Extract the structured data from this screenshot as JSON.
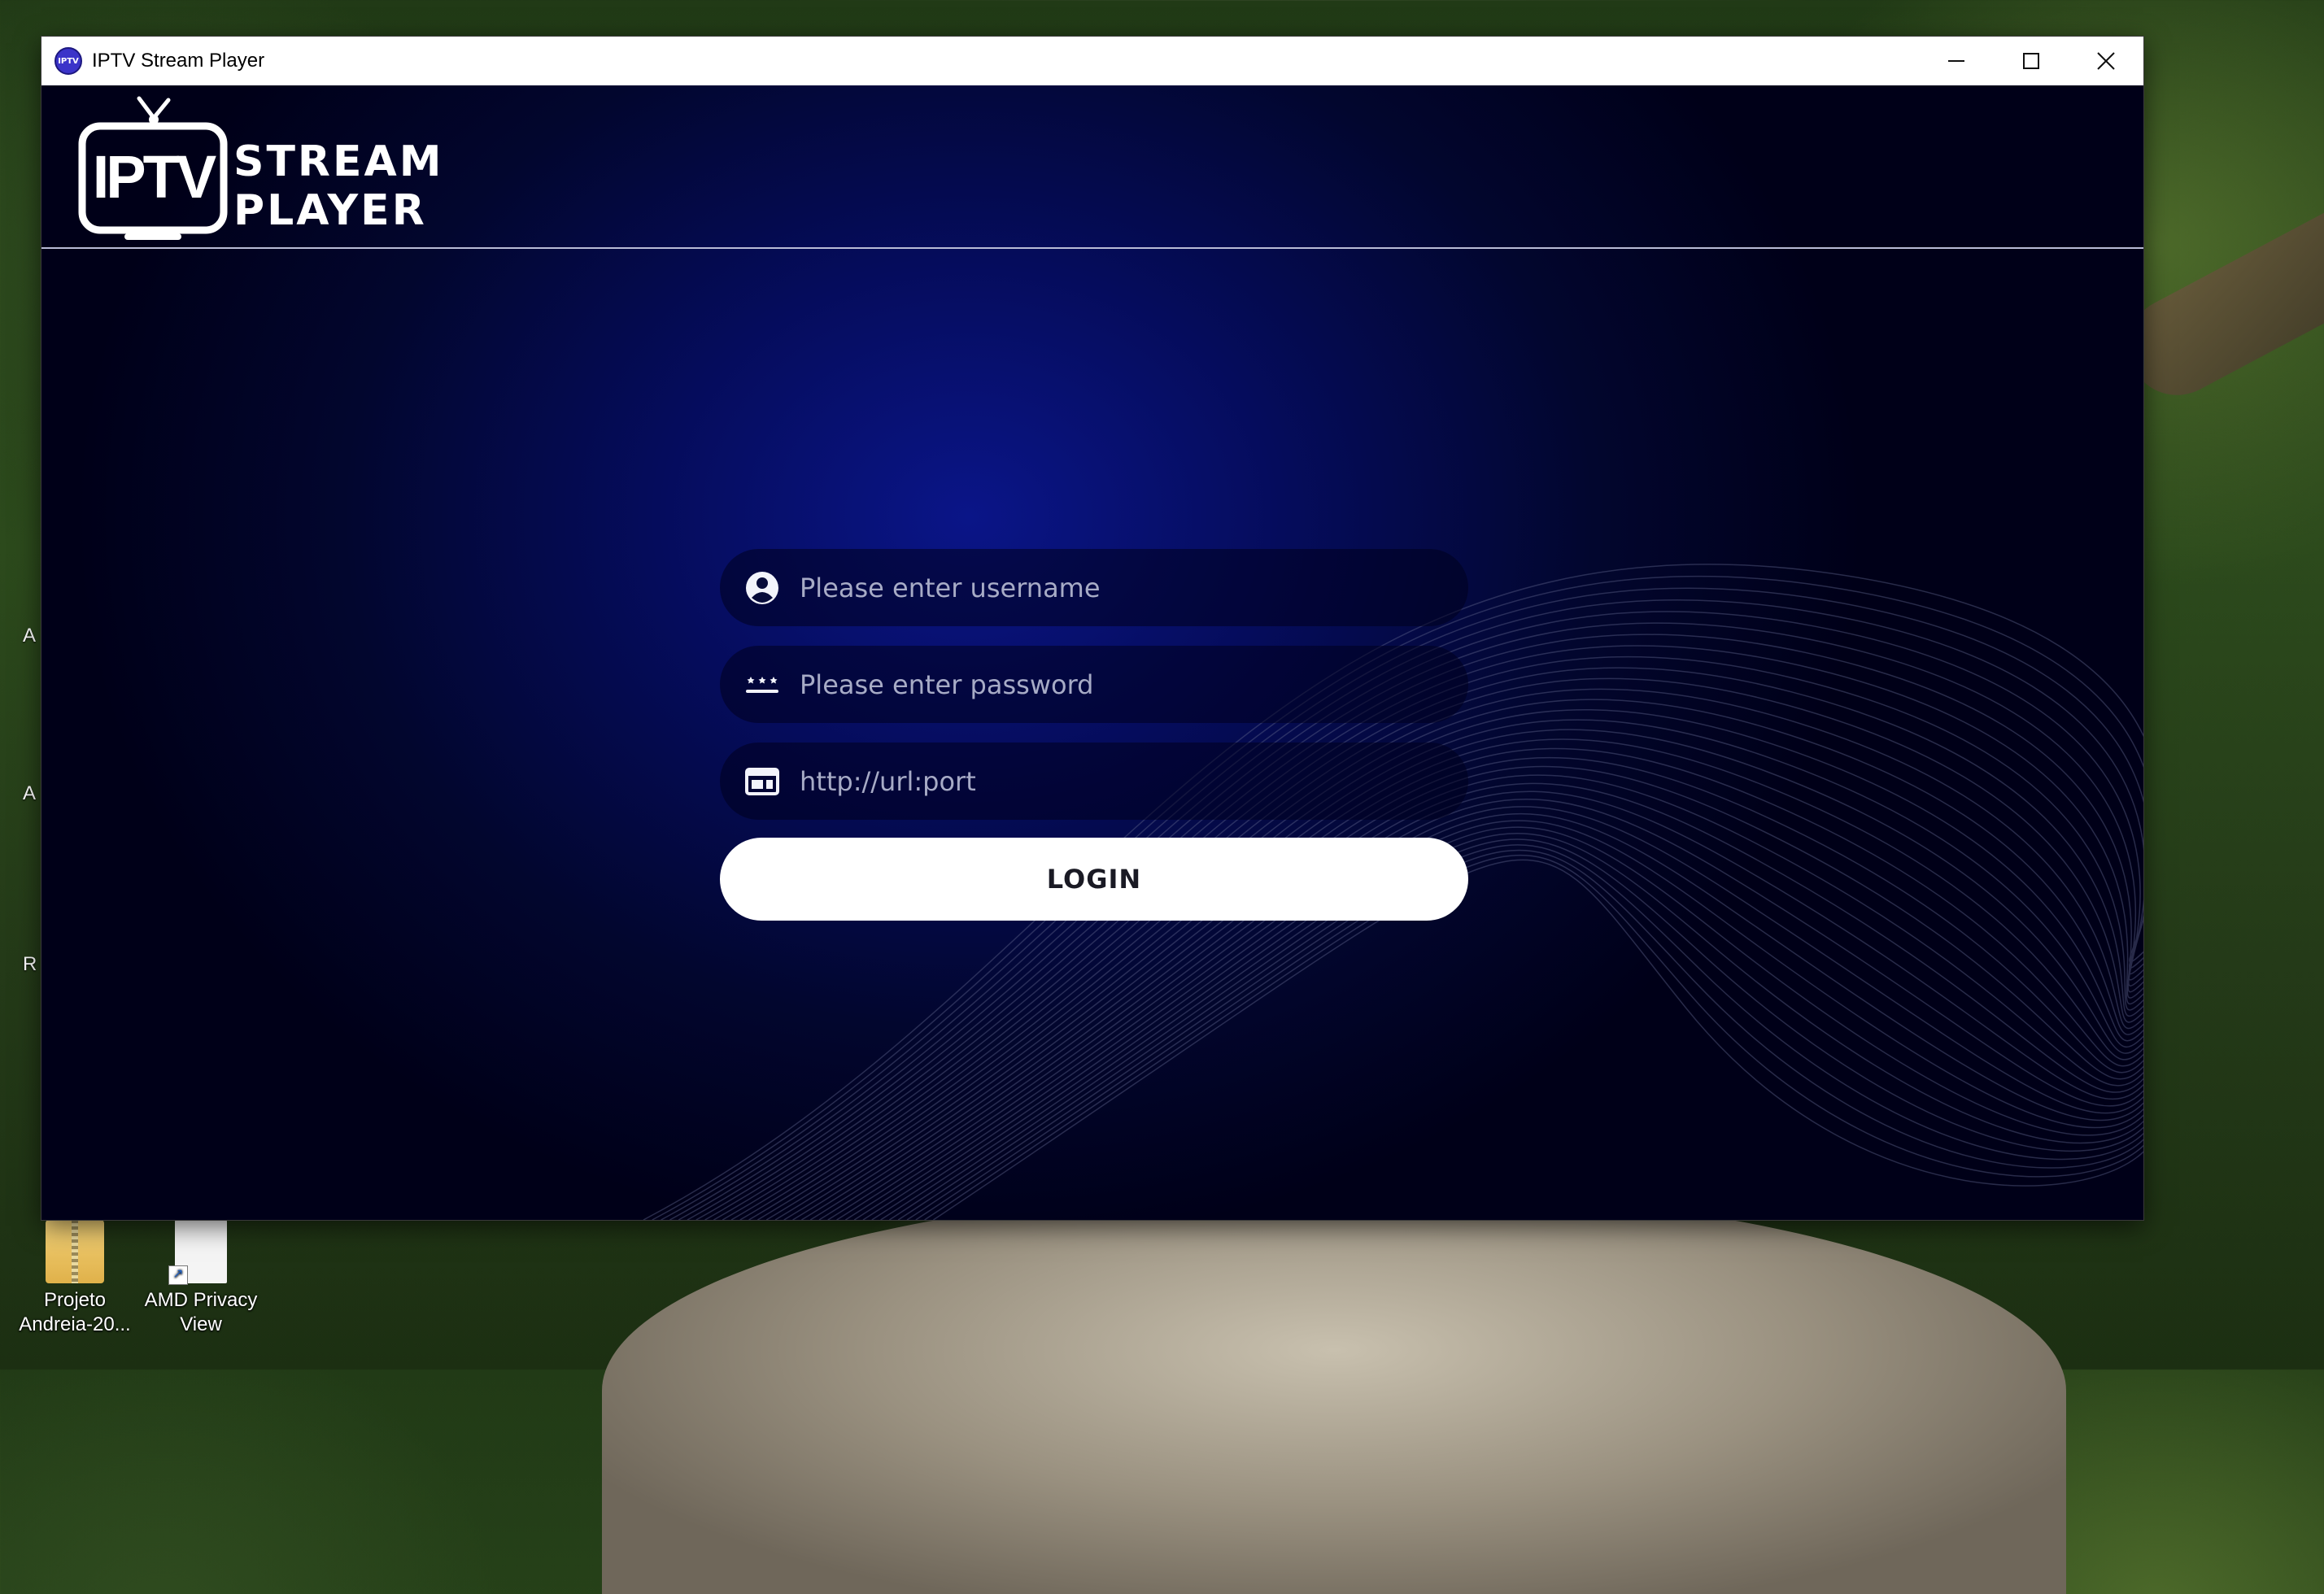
{
  "window": {
    "title": "IPTV Stream Player",
    "app_icon_label": "IPTV"
  },
  "logo": {
    "badge_text": "IPTV",
    "line1": "STREAM",
    "line2": "PLAYER"
  },
  "login_form": {
    "username_placeholder": "Please enter username",
    "password_placeholder": "Please enter password",
    "url_placeholder": "http://url:port",
    "login_label": "LOGIN"
  },
  "desktop": {
    "icons": [
      {
        "line1": "Projeto",
        "line2": "Andreia-20...",
        "icon": "zip-folder-icon"
      },
      {
        "line1": "AMD Privacy",
        "line2": "View",
        "icon": "shortcut-file-icon"
      }
    ]
  },
  "colors": {
    "background_center": "#0a1588",
    "background_edge": "#000018",
    "field_bg": "#00001e",
    "button_bg": "#ffffff"
  }
}
